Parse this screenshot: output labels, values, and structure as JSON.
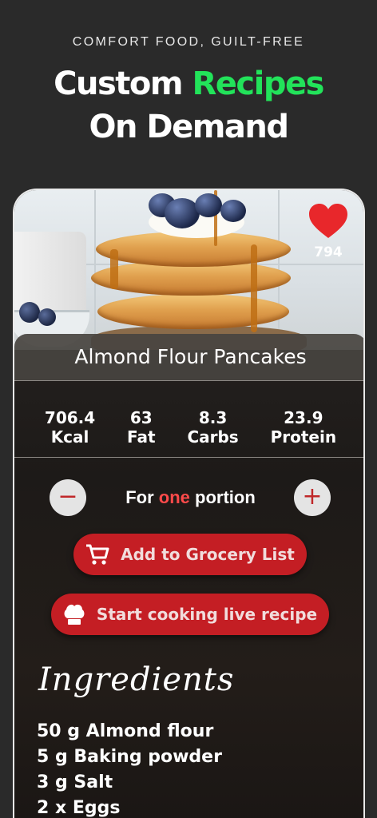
{
  "header": {
    "tagline": "COMFORT FOOD, GUILT-FREE",
    "headline_part1": "Custom ",
    "headline_accent": "Recipes",
    "headline_line2": "On Demand"
  },
  "recipe": {
    "title": "Almond Flour Pancakes",
    "likes": "794",
    "like_icon": "heart-icon",
    "nutrients": [
      {
        "value": "706.4",
        "label": "Kcal"
      },
      {
        "value": "63",
        "label": "Fat"
      },
      {
        "value": "8.3",
        "label": "Carbs"
      },
      {
        "value": "23.9",
        "label": "Protein"
      }
    ]
  },
  "portion": {
    "minus": "−",
    "plus": "+",
    "prefix": "For ",
    "count": "one",
    "suffix": " portion"
  },
  "actions": {
    "grocery_label": "Add to Grocery List",
    "grocery_icon": "cart-icon",
    "cook_label": "Start cooking live recipe",
    "cook_icon": "chef-hat-icon"
  },
  "ingredients": {
    "title": "Ingredients",
    "items": [
      "50 g Almond flour",
      "5 g Baking powder",
      "3 g Salt",
      "2 x Eggs"
    ]
  },
  "colors": {
    "accent_green": "#22e35a",
    "brand_red": "#c41e24",
    "heart_red": "#e8272b"
  }
}
